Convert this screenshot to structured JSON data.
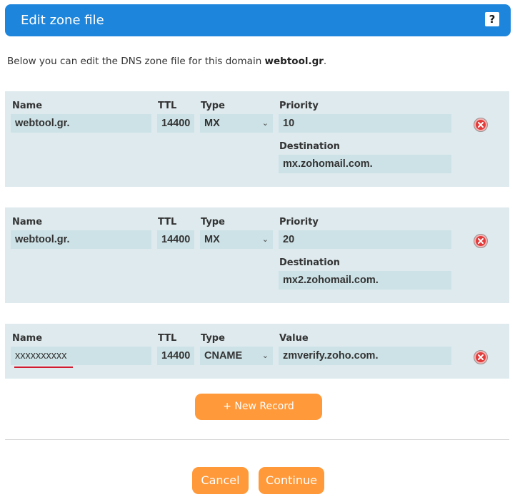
{
  "header": {
    "title": "Edit zone file",
    "help_label": "?"
  },
  "intro": {
    "text": "Below you can edit the DNS zone file for this domain ",
    "domain": "webtool.gr",
    "suffix": "."
  },
  "labels": {
    "name": "Name",
    "ttl": "TTL",
    "type": "Type",
    "priority": "Priority",
    "destination": "Destination",
    "value": "Value"
  },
  "records": [
    {
      "name": "webtool.gr.",
      "ttl": "14400",
      "type": "MX",
      "priority": "10",
      "destination": "mx.zohomail.com."
    },
    {
      "name": "webtool.gr.",
      "ttl": "14400",
      "type": "MX",
      "priority": "20",
      "destination": "mx2.zohomail.com."
    },
    {
      "name": "xxxxxxxxxx",
      "ttl": "14400",
      "type": "CNAME",
      "value": "zmverify.zoho.com."
    }
  ],
  "buttons": {
    "new_record": "+ New Record",
    "cancel": "Cancel",
    "continue": "Continue"
  },
  "colors": {
    "header": "#1d86dc",
    "accent": "#ff993a",
    "record_bg": "#deeaee",
    "field_bg": "#cde2e6",
    "delete": "#e23b3b"
  }
}
